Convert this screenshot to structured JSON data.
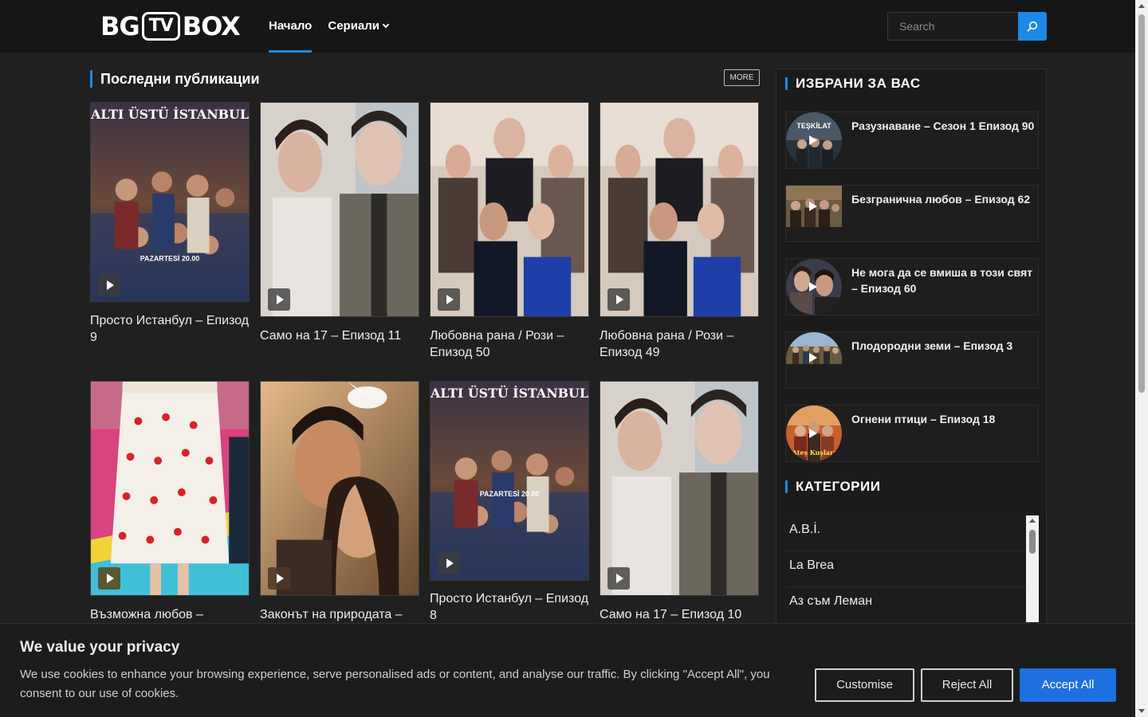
{
  "header": {
    "logo": {
      "left": "BG",
      "middle": "TV",
      "right": "BOX"
    },
    "nav": [
      {
        "label": "Начало",
        "active": true
      },
      {
        "label": "Сериали",
        "dropdown": true
      }
    ],
    "search_placeholder": "Search"
  },
  "main": {
    "section_title": "Последни публикации",
    "more_label": "MORE",
    "posts": [
      {
        "title": "Просто Истанбул – Епизод 9",
        "poster_text": "ALTI ÜSTÜ İSTANBUL",
        "poster_sub": "PAZARTESİ 20.00"
      },
      {
        "title": "Само на 17 – Епизод 11"
      },
      {
        "title": "Любовна рана / Рози – Епизод 50"
      },
      {
        "title": "Любовна рана / Рози – Епизод 49"
      },
      {
        "title": "Възможна любов –"
      },
      {
        "title": "Законът на природата –"
      },
      {
        "title": "Просто Истанбул – Епизод 8",
        "poster_text": "ALTI ÜSTÜ İSTANBUL",
        "poster_sub": "PAZARTESİ 20.00"
      },
      {
        "title": "Само на 17 – Епизод 10"
      }
    ]
  },
  "sidebar": {
    "featured_title": "ИЗБРАНИ ЗА ВАС",
    "featured": [
      {
        "title": "Разузнаване – Сезон 1 Епизод 90",
        "thumb_text": "TEŞKİLAT"
      },
      {
        "title": "Безгранична любов – Епизод 62"
      },
      {
        "title": "Не мога да се вмиша в този свят – Епизод 60"
      },
      {
        "title": "Плодородни земи – Епизод 3"
      },
      {
        "title": "Огнени птици – Епизод 18",
        "thumb_text": "Ateş Kuşları"
      }
    ],
    "categories_title": "КАТЕГОРИИ",
    "categories": [
      "A.B.İ.",
      "La Brea",
      "Аз съм Леман"
    ]
  },
  "cookie": {
    "title": "We value your privacy",
    "text": "We use cookies to enhance your browsing experience, serve personalised ads or content, and analyse our traffic. By clicking \"Accept All\", you consent to our use of cookies.",
    "customise_label": "Customise",
    "reject_label": "Reject All",
    "accept_label": "Accept All"
  },
  "colors": {
    "accent": "#1e88e5",
    "background": "#202020",
    "header": "#161616",
    "accept_button": "#1e6fe0"
  }
}
